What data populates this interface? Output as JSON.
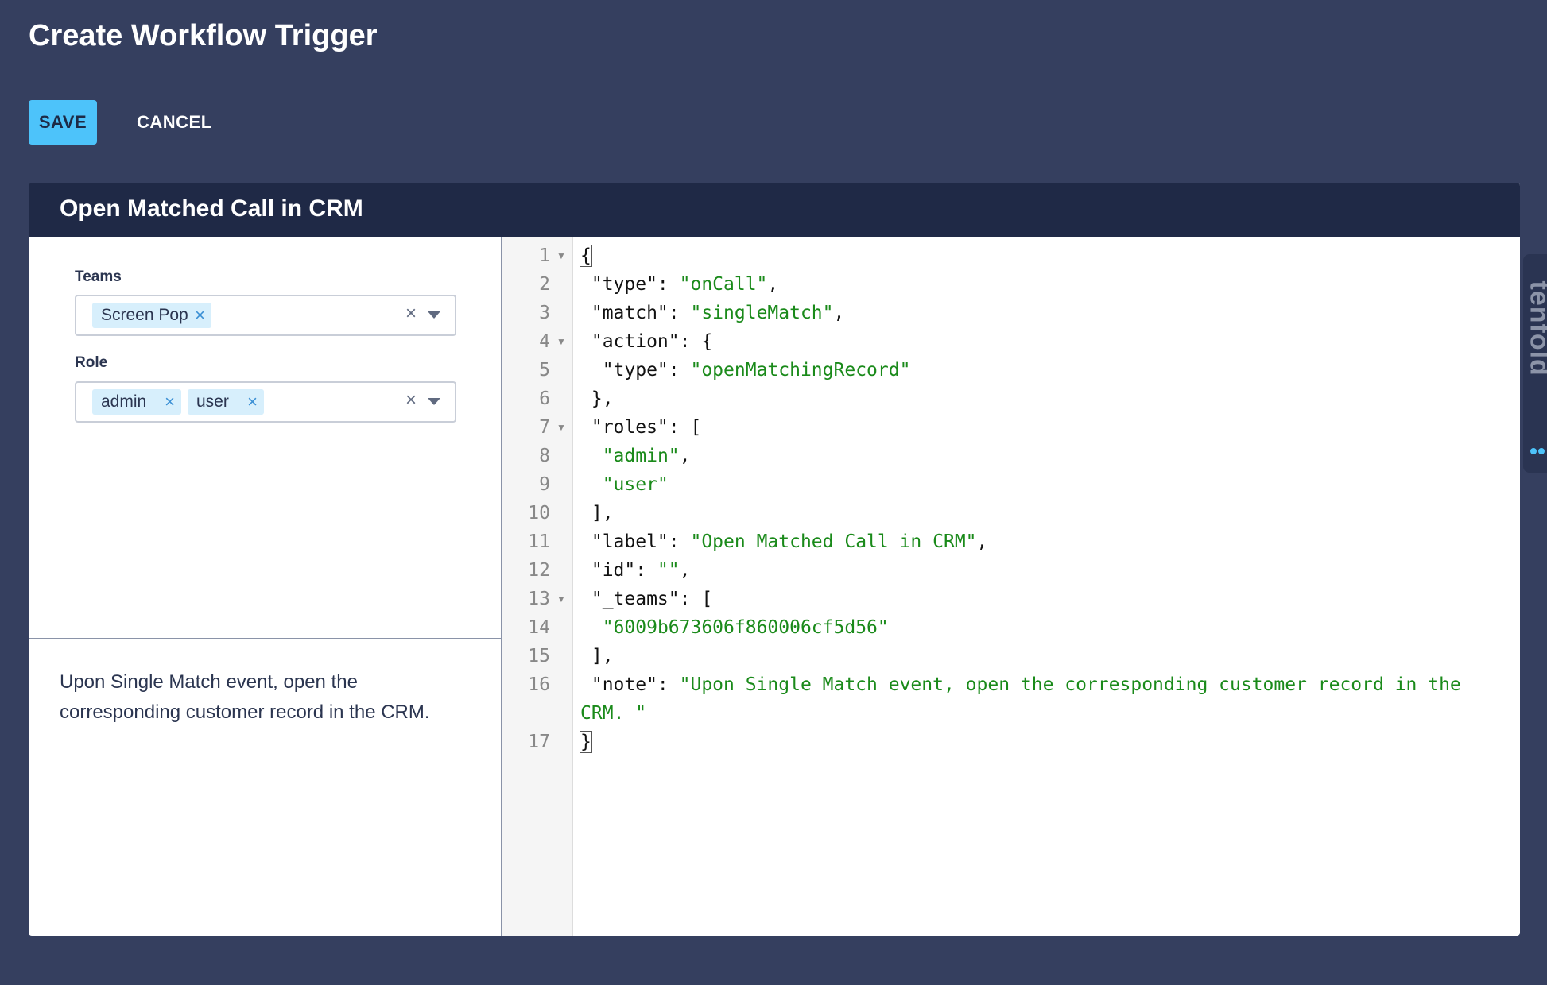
{
  "page": {
    "title": "Create Workflow Trigger",
    "save_label": "SAVE",
    "cancel_label": "CANCEL"
  },
  "trigger": {
    "title": "Open Matched Call in CRM",
    "teams": {
      "label": "Teams",
      "chips": [
        "Screen Pop"
      ]
    },
    "role": {
      "label": "Role",
      "chips": [
        "admin",
        "user"
      ]
    },
    "note": "Upon Single Match event, open the corresponding customer record in the CRM."
  },
  "editor": {
    "lines": [
      {
        "n": "1",
        "fold": true,
        "parts": [
          {
            "t": "{",
            "c": "bracket"
          }
        ]
      },
      {
        "n": "2",
        "fold": false,
        "parts": [
          {
            "t": " \"type\": "
          },
          {
            "t": "\"onCall\"",
            "c": "str"
          },
          {
            "t": ","
          }
        ]
      },
      {
        "n": "3",
        "fold": false,
        "parts": [
          {
            "t": " \"match\": "
          },
          {
            "t": "\"singleMatch\"",
            "c": "str"
          },
          {
            "t": ","
          }
        ]
      },
      {
        "n": "4",
        "fold": true,
        "parts": [
          {
            "t": " \"action\": {"
          }
        ]
      },
      {
        "n": "5",
        "fold": false,
        "parts": [
          {
            "t": "  \"type\": "
          },
          {
            "t": "\"openMatchingRecord\"",
            "c": "str"
          }
        ]
      },
      {
        "n": "6",
        "fold": false,
        "parts": [
          {
            "t": " },"
          }
        ]
      },
      {
        "n": "7",
        "fold": true,
        "parts": [
          {
            "t": " \"roles\": ["
          }
        ]
      },
      {
        "n": "8",
        "fold": false,
        "parts": [
          {
            "t": "  "
          },
          {
            "t": "\"admin\"",
            "c": "str"
          },
          {
            "t": ","
          }
        ]
      },
      {
        "n": "9",
        "fold": false,
        "parts": [
          {
            "t": "  "
          },
          {
            "t": "\"user\"",
            "c": "str"
          }
        ]
      },
      {
        "n": "10",
        "fold": false,
        "parts": [
          {
            "t": " ],"
          }
        ]
      },
      {
        "n": "11",
        "fold": false,
        "parts": [
          {
            "t": " \"label\": "
          },
          {
            "t": "\"Open Matched Call in CRM\"",
            "c": "str"
          },
          {
            "t": ","
          }
        ]
      },
      {
        "n": "12",
        "fold": false,
        "parts": [
          {
            "t": " \"id\": "
          },
          {
            "t": "\"\"",
            "c": "str"
          },
          {
            "t": ","
          }
        ]
      },
      {
        "n": "13",
        "fold": true,
        "parts": [
          {
            "t": " \"_teams\": ["
          }
        ]
      },
      {
        "n": "14",
        "fold": false,
        "parts": [
          {
            "t": "  "
          },
          {
            "t": "\"6009b673606f860006cf5d56\"",
            "c": "str"
          }
        ]
      },
      {
        "n": "15",
        "fold": false,
        "parts": [
          {
            "t": " ],"
          }
        ]
      },
      {
        "n": "16",
        "fold": false,
        "parts": [
          {
            "t": " \"note\": "
          },
          {
            "t": "\"Upon Single Match event, open the corresponding customer record in the",
            "c": "str"
          }
        ]
      },
      {
        "n": "",
        "fold": false,
        "parts": [
          {
            "t": "CRM. \"",
            "c": "str"
          }
        ]
      },
      {
        "n": "17",
        "fold": false,
        "parts": [
          {
            "t": "}",
            "c": "bracket"
          }
        ]
      }
    ]
  },
  "brand": {
    "name": "tenfold"
  },
  "icons": {
    "chip_remove": "close-icon",
    "clear": "clear-icon",
    "dropdown": "chevron-down-icon",
    "fold": "fold-arrow-icon"
  },
  "colors": {
    "background": "#353f5f",
    "header": "#1f2946",
    "accent": "#4dc3fa",
    "chip": "#d7effc",
    "string": "#1a8a1a"
  }
}
